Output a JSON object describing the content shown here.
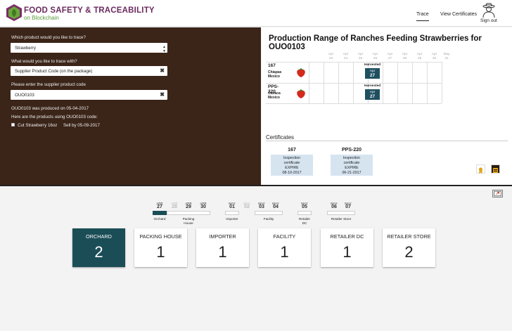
{
  "brand": {
    "title": "FOOD SAFETY & TRACEABILITY",
    "subtitle": "on Blockchain"
  },
  "nav": {
    "trace": "Trace",
    "certificates": "View Certificates",
    "signout": "Sign out"
  },
  "form": {
    "q1": "Which product would you like to trace?",
    "product": "Strawberry",
    "q2": "What would you like to trace with?",
    "trace_with": "Supplier Product Code (on the package)",
    "q3": "Please enter the supplier product code",
    "code": "OUO0103",
    "produced": "OUO0103 was produced on 05-04-2017",
    "products_using": "Here are the products using OUO0103 code:",
    "item_name": "Cut Strawberry 16oz",
    "item_sell": "Sell by 05-09-2017"
  },
  "production": {
    "title": "Production Range of Ranches Feeding Strawberries for OUO0103",
    "days": [
      {
        "m": "Apr",
        "d": "23"
      },
      {
        "m": "Apr",
        "d": "24"
      },
      {
        "m": "Apr",
        "d": "25"
      },
      {
        "m": "Apr",
        "d": "26"
      },
      {
        "m": "Apr",
        "d": "27"
      },
      {
        "m": "Apr",
        "d": "28"
      },
      {
        "m": "Apr",
        "d": "29"
      },
      {
        "m": "Apr",
        "d": "30"
      },
      {
        "m": "May",
        "d": "31"
      }
    ],
    "ranches": [
      {
        "id": "167",
        "name": "Chiapas Mexico",
        "harvest_label": "Harvested",
        "harvest_month": "Apr",
        "harvest_day": "27"
      },
      {
        "id": "PPS-220",
        "name": "Oaxaca Mexico",
        "harvest_label": "Harvested",
        "harvest_month": "Apr",
        "harvest_day": "27"
      }
    ]
  },
  "certificates": {
    "title": "Certificates",
    "items": [
      {
        "id": "167",
        "l1": "Inspection",
        "l2": "certificate",
        "l3": "EXPIRE",
        "date": "08-10-2017"
      },
      {
        "id": "PPS-220",
        "l1": "Inspection",
        "l2": "certificate",
        "l3": "EXPIRE",
        "date": "06-21-2017"
      }
    ]
  },
  "timeline": {
    "dates": [
      {
        "m": "APR",
        "d": "27"
      },
      {
        "m": "APR",
        "d": "28"
      },
      {
        "m": "APR",
        "d": "29"
      },
      {
        "m": "APR",
        "d": "30"
      },
      {
        "m": "MAY",
        "d": "01"
      },
      {
        "m": "MAY",
        "d": "02"
      },
      {
        "m": "MAY",
        "d": "03"
      },
      {
        "m": "MAY",
        "d": "04"
      },
      {
        "m": "MAY",
        "d": "05"
      },
      {
        "m": "MAY",
        "d": "06"
      },
      {
        "m": "MAY",
        "d": "07"
      }
    ],
    "labels": [
      "Orchard",
      "Packing House",
      "Importer",
      "Facility",
      "Retailer DC",
      "Retailer Store"
    ]
  },
  "stages": [
    {
      "name": "ORCHARD",
      "count": "2"
    },
    {
      "name": "PACKING HOUSE",
      "count": "1"
    },
    {
      "name": "IMPORTER",
      "count": "1"
    },
    {
      "name": "FACILITY",
      "count": "1"
    },
    {
      "name": "RETAILER DC",
      "count": "1"
    },
    {
      "name": "RETAILER STORE",
      "count": "2"
    }
  ],
  "colors": {
    "accent": "#1b4d57",
    "dark_panel": "#3b2418",
    "brand": "#6b2a5e"
  },
  "icons": [
    "leaf-logo-icon",
    "farmer-avatar-icon",
    "strawberry-icon",
    "award-icon",
    "certificate-icon",
    "expand-icon"
  ]
}
